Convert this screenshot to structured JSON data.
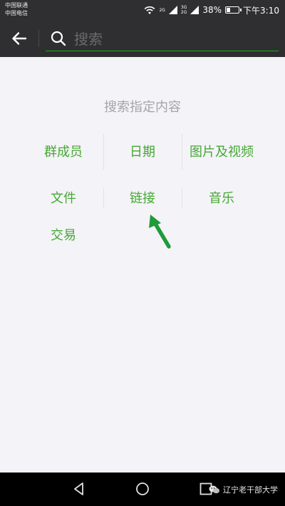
{
  "status_bar": {
    "carrier_1": "中国联通",
    "carrier_2": "中国电信",
    "sig1_tag": "2G",
    "sig2_tag_top": "3G",
    "sig2_tag_bottom": "2G",
    "battery": "38%",
    "battery_level": 0.38,
    "time": "下午3:10"
  },
  "search": {
    "placeholder": "搜索",
    "value": ""
  },
  "content": {
    "section_title": "搜索指定内容",
    "categories": [
      {
        "label": "群成员"
      },
      {
        "label": "日期"
      },
      {
        "label": "图片及视频"
      },
      {
        "label": "文件"
      },
      {
        "label": "链接"
      },
      {
        "label": "音乐"
      },
      {
        "label": "交易"
      }
    ]
  },
  "watermark": {
    "text": "辽宁老干部大学"
  },
  "colors": {
    "accent_green": "#46a835",
    "arrow_green": "#1e9b3a",
    "toolbar_bg": "#2f2f31",
    "page_bg": "#f4f3f7"
  },
  "icons": [
    "back-arrow-icon",
    "search-icon",
    "wifi-icon",
    "signal-icon",
    "battery-icon",
    "nav-back-icon",
    "nav-home-icon",
    "nav-recent-icon",
    "wechat-icon"
  ]
}
